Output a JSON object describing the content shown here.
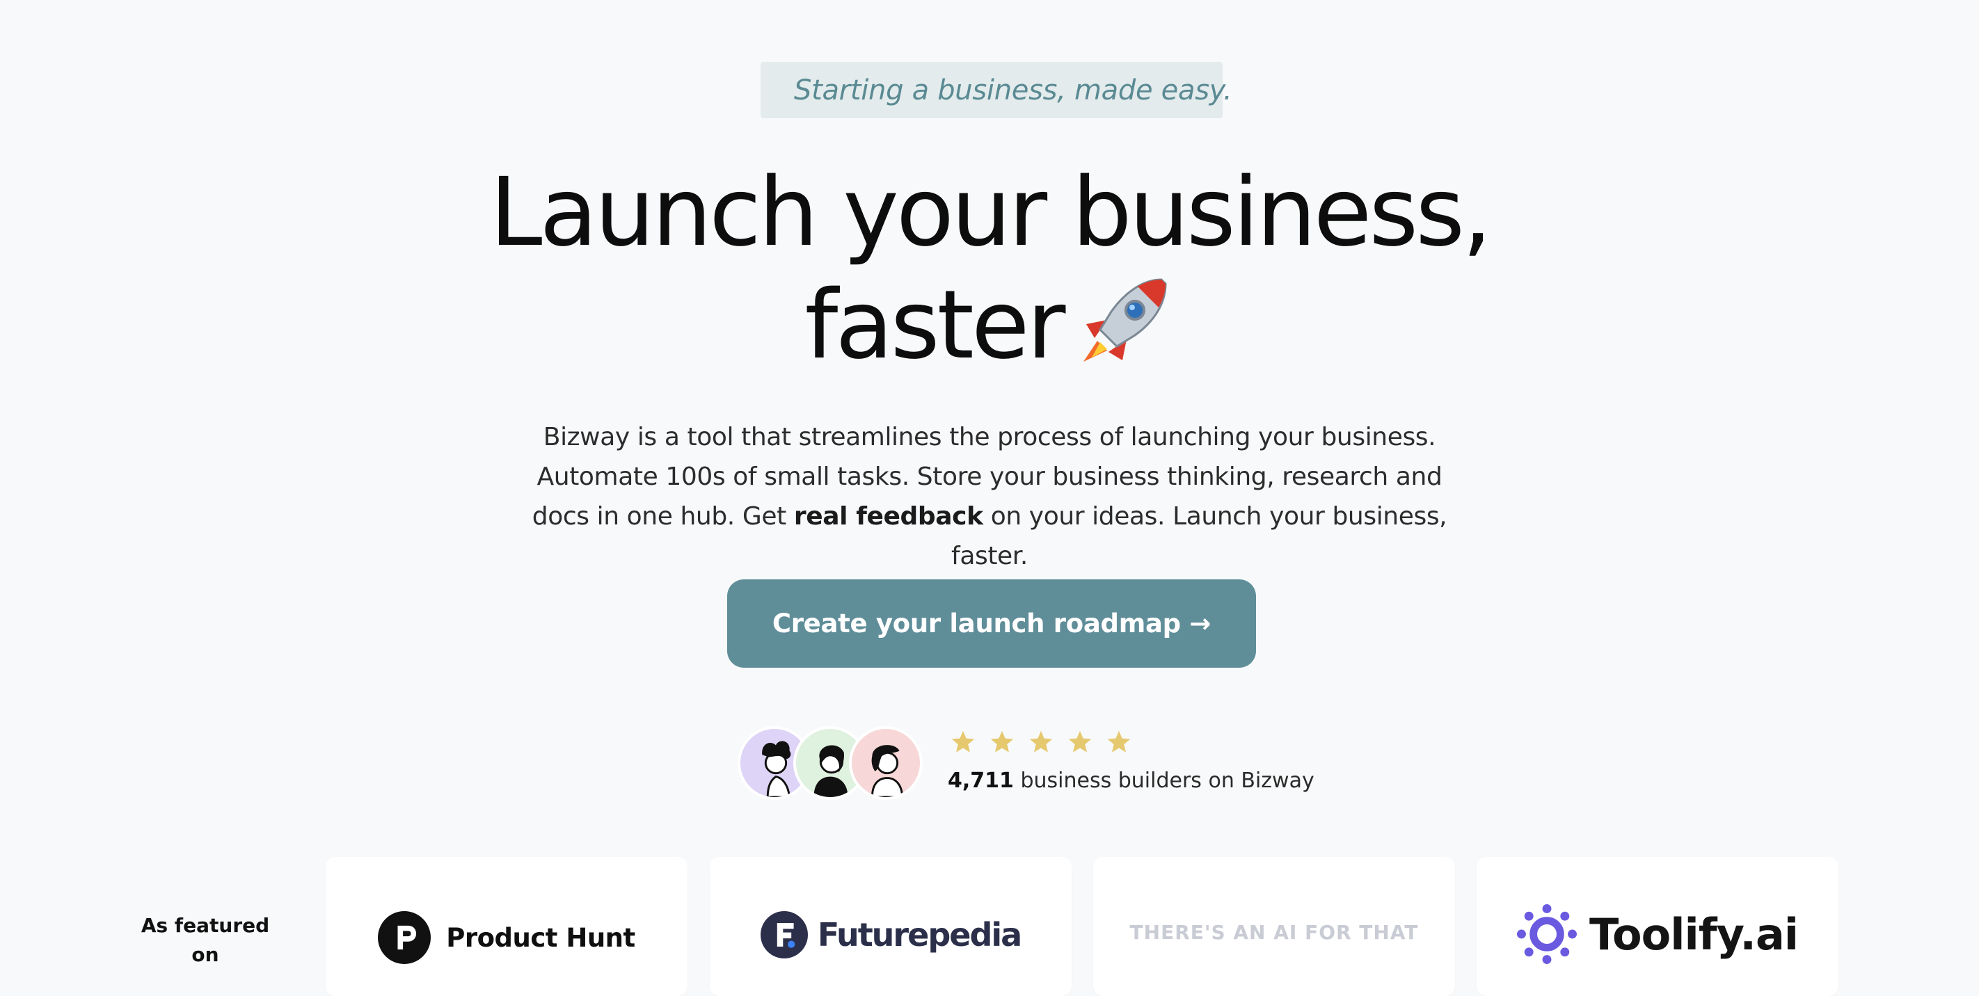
{
  "hero": {
    "tagline": "Starting a business, made easy.",
    "headline_line1": "Launch your business,",
    "headline_line2": "faster",
    "description_part1": "Bizway is a tool that streamlines the process of launching your business. Automate 100s of small tasks. Store your business thinking, research and docs in one hub. Get",
    "description_bold": "real feedback",
    "description_part2": "on your ideas. Launch your business, faster.",
    "cta_label": "Create your launch roadmap →"
  },
  "social_proof": {
    "rating_stars": 5,
    "count": "4,711",
    "text": "business builders on Bizway",
    "avatars": [
      "avatar-purple",
      "avatar-green",
      "avatar-pink"
    ]
  },
  "featured": {
    "label": "As featured on",
    "items": [
      "Product Hunt",
      "Futurepedia",
      "THERE'S AN AI FOR THAT",
      "Toolify.ai"
    ]
  },
  "colors": {
    "background": "#f7f9fa",
    "accent": "#5f8e99",
    "tagline_bg": "#e3ebec",
    "star": "#e6c86e"
  }
}
